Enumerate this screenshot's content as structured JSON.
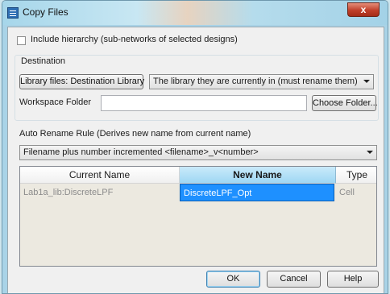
{
  "window": {
    "title": "Copy Files",
    "close_label": "x"
  },
  "include_hierarchy": {
    "label": "Include hierarchy (sub-networks of selected designs)",
    "checked": false
  },
  "destination": {
    "group_label": "Destination",
    "library_files_button": "Library files: Destination Library",
    "library_combo_value": "The library they are currently in (must rename them)",
    "workspace_label": "Workspace Folder",
    "workspace_value": "",
    "choose_folder_button": "Choose Folder..."
  },
  "auto_rename": {
    "label": "Auto Rename Rule (Derives new name from current name)",
    "combo_value": "Filename plus number incremented  <filename>_v<number>"
  },
  "table": {
    "headers": [
      "Current Name",
      "New Name",
      "Type"
    ],
    "rows": [
      {
        "current_name": "Lab1a_lib:DiscreteLPF",
        "new_name": "DiscreteLPF_Opt",
        "type": "Cell"
      }
    ]
  },
  "buttons": {
    "ok": "OK",
    "cancel": "Cancel",
    "help": "Help"
  },
  "colors": {
    "selection": "#1e90ff",
    "selected_header": "#9fd7f3",
    "dimmed_text": "#8c8c8c"
  }
}
